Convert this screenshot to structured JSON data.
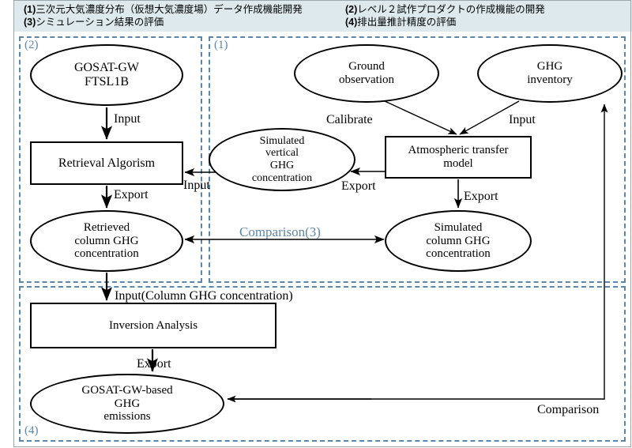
{
  "header": {
    "items": [
      {
        "num": "(1)",
        "text": "三次元大気濃度分布（仮想大気濃度場）データ作成機能開発"
      },
      {
        "num": "(2)",
        "text": "レベル２試作プロダクトの作成機能の開発"
      },
      {
        "num": "(3)",
        "text": "シミュレーション結果の評価"
      },
      {
        "num": "(4)",
        "text": "排出量推計精度の評価"
      }
    ]
  },
  "groups": {
    "g1_label": "(1)",
    "g2_label": "(2)",
    "g4_label": "(4)"
  },
  "nodes": {
    "ftsl1b": "GOSAT-GW\nFTSL1B",
    "retrieval_algorism": "Retrieval Algorism",
    "retrieved_column": "Retrieved\ncolumn GHG\nconcentration",
    "ground_observation": "Ground\nobservation",
    "ghg_inventory": "GHG\ninventory",
    "simulated_vertical": "Simulated\nvertical\nGHG\nconcentration",
    "atmospheric_transfer_model": "Atmospheric transfer\nmodel",
    "simulated_column": "Simulated\ncolumn GHG\nconcentration",
    "inversion_analysis": "Inversion Analysis",
    "gosat_emissions": "GOSAT-GW-based\nGHG\nemissions"
  },
  "edges": {
    "input_to_retrieval": "Input",
    "export_from_retrieval": "Export",
    "input_from_simvert": "Input",
    "calibrate": "Calibrate",
    "input_to_atm": "Input",
    "export_to_simvert": "Export",
    "export_to_simcol": "Export",
    "comparison3": "Comparison(3)",
    "input_column": "Input(Column GHG concentration)",
    "export_to_emissions": "Export",
    "comparison": "Comparison"
  },
  "colors": {
    "accent_blue": "#5b87ad",
    "header_bg": "#dde9ec",
    "stroke": "#000000"
  }
}
